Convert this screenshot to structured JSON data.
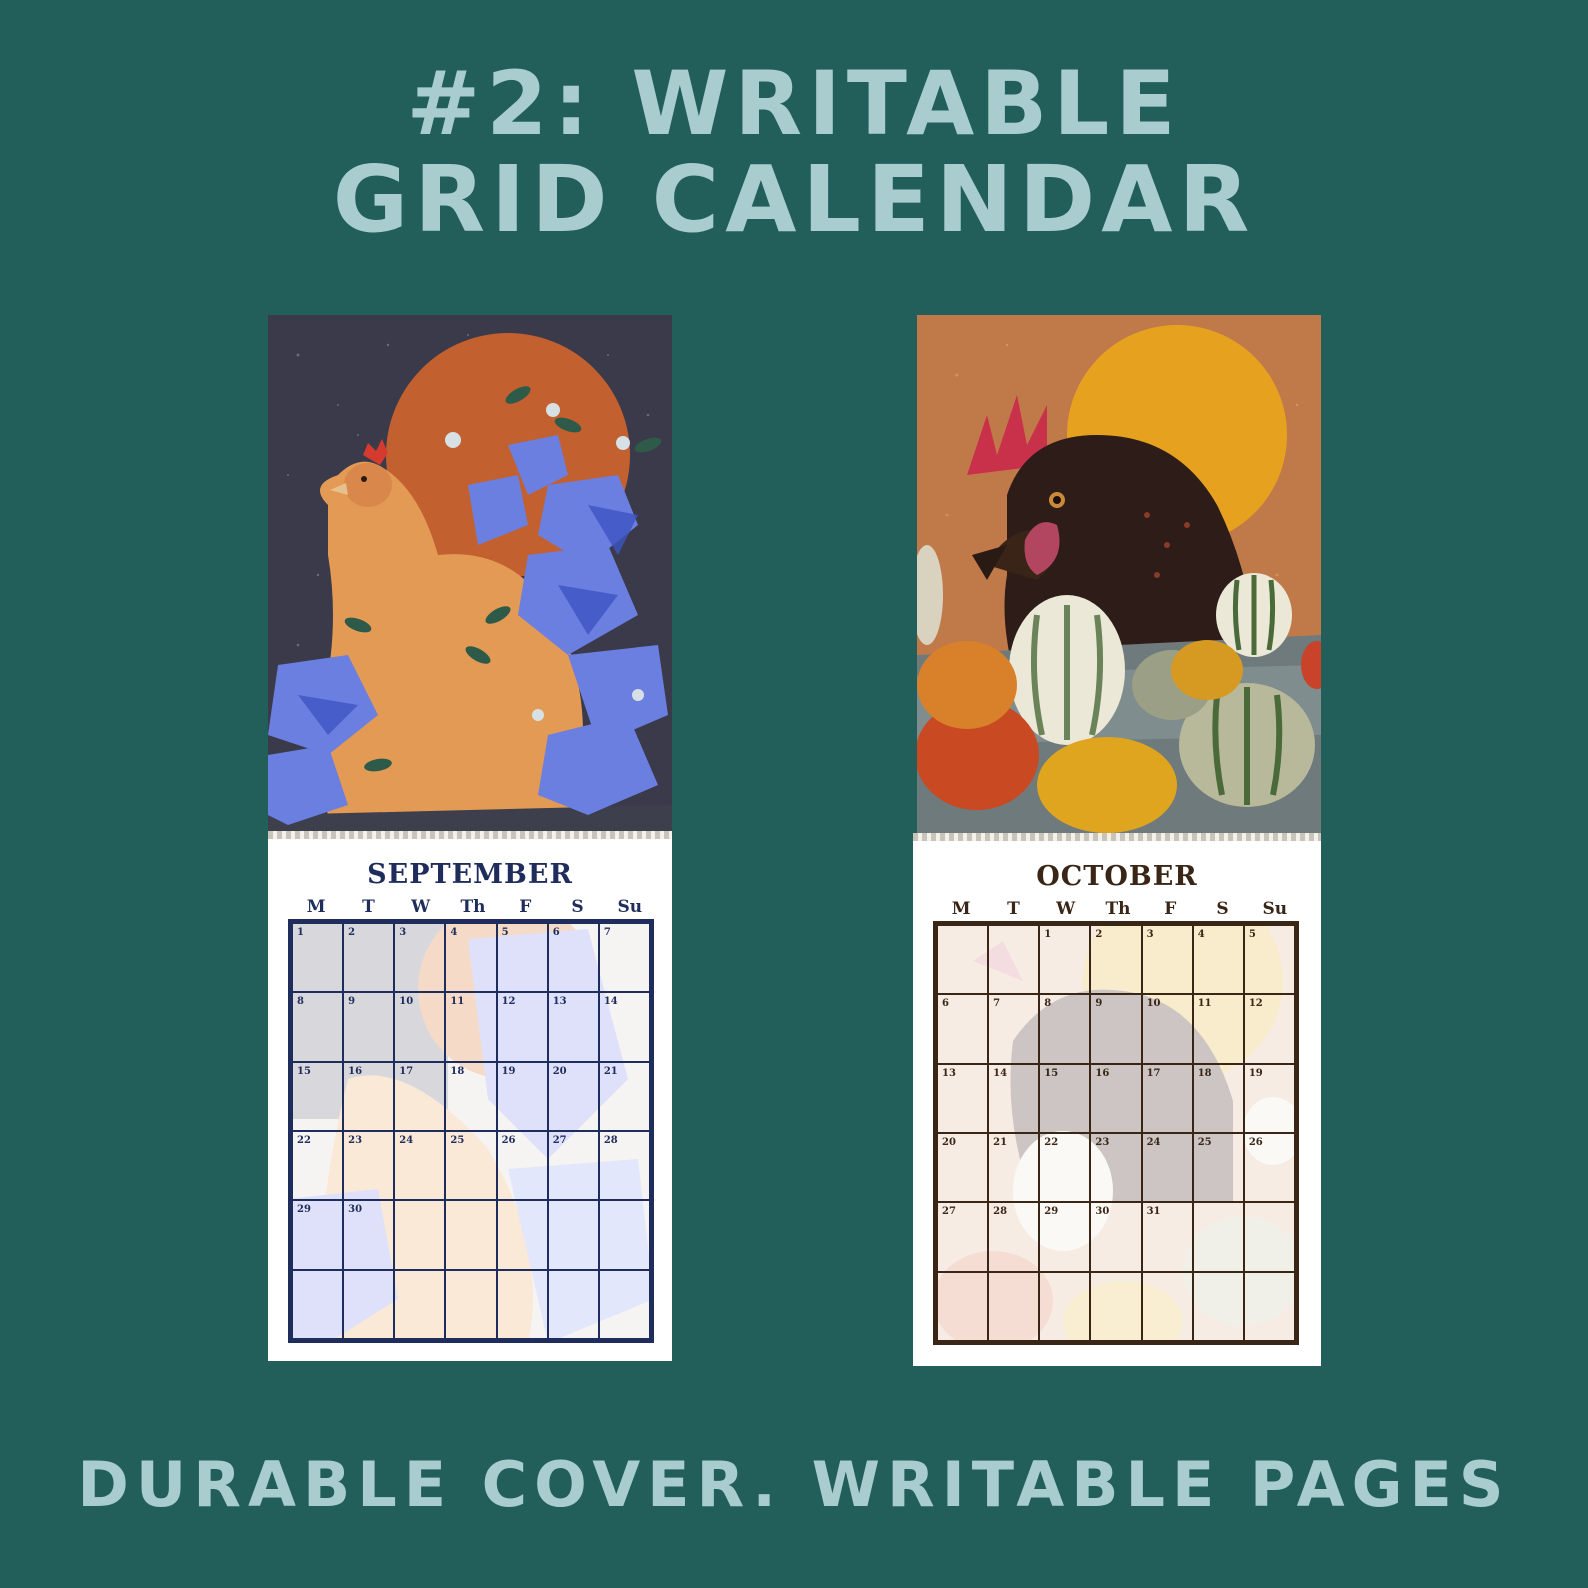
{
  "title": {
    "line1": "#2: WRITABLE",
    "line2": "GRID CALENDAR"
  },
  "footer": "DURABLE COVER. WRITABLE PAGES",
  "colors": {
    "background": "#225f5a",
    "headline": "#a9cdcf",
    "september_ink": "#1f2d5c",
    "october_ink": "#3a2616"
  },
  "weekdays": [
    "M",
    "T",
    "W",
    "Th",
    "F",
    "S",
    "Su"
  ],
  "calendars": [
    {
      "month": "SEPTEMBER",
      "illustration": "hen-with-blue-clematis-and-orange-moon",
      "days": [
        "1",
        "2",
        "3",
        "4",
        "5",
        "6",
        "7",
        "8",
        "9",
        "10",
        "11",
        "12",
        "13",
        "14",
        "15",
        "16",
        "17",
        "18",
        "19",
        "20",
        "21",
        "22",
        "23",
        "24",
        "25",
        "26",
        "27",
        "28",
        "29",
        "30",
        "",
        "",
        "",
        "",
        "",
        "",
        "",
        "",
        "",
        "",
        "",
        ""
      ]
    },
    {
      "month": "OCTOBER",
      "illustration": "black-hen-with-gourds-and-yellow-moon",
      "days": [
        "",
        "",
        "1",
        "2",
        "3",
        "4",
        "5",
        "6",
        "7",
        "8",
        "9",
        "10",
        "11",
        "12",
        "13",
        "14",
        "15",
        "16",
        "17",
        "18",
        "19",
        "20",
        "21",
        "22",
        "23",
        "24",
        "25",
        "26",
        "27",
        "28",
        "29",
        "30",
        "31",
        "",
        "",
        "",
        "",
        "",
        "",
        "",
        "",
        ""
      ]
    }
  ]
}
